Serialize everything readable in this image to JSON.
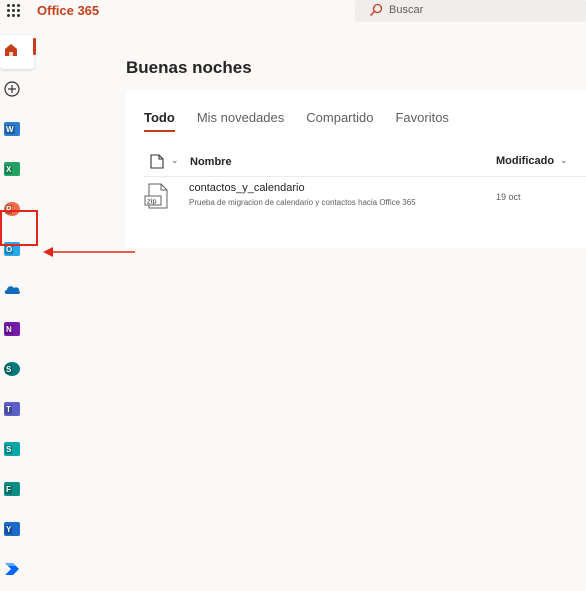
{
  "header": {
    "app_title": "Office 365",
    "search_placeholder": "Buscar"
  },
  "rail": {
    "apps": [
      {
        "name": "home",
        "color": "#c43e1c"
      },
      {
        "name": "create",
        "label": "+"
      },
      {
        "name": "word",
        "letter": "W",
        "color": "#185abd"
      },
      {
        "name": "excel",
        "letter": "X",
        "color": "#107c41"
      },
      {
        "name": "powerpoint",
        "letter": "P",
        "color": "#c43e1c"
      },
      {
        "name": "outlook",
        "letter": "O",
        "color": "#0078d4"
      },
      {
        "name": "onedrive",
        "color": "#0364b8"
      },
      {
        "name": "onenote",
        "letter": "N",
        "color": "#7719aa"
      },
      {
        "name": "sharepoint",
        "letter": "S",
        "color": "#038387"
      },
      {
        "name": "teams",
        "letter": "T",
        "color": "#4b53bc"
      },
      {
        "name": "sway",
        "letter": "S",
        "color": "#008272"
      },
      {
        "name": "forms",
        "letter": "F",
        "color": "#037c71"
      },
      {
        "name": "yammer",
        "letter": "Y",
        "color": "#106ebe"
      },
      {
        "name": "power-automate",
        "color": "#0066ff"
      }
    ]
  },
  "main": {
    "greeting": "Buenas noches",
    "tabs": [
      "Todo",
      "Mis novedades",
      "Compartido",
      "Favoritos"
    ],
    "columns": {
      "name": "Nombre",
      "modified": "Modificado"
    },
    "files": [
      {
        "name": "contactos_y_calendario",
        "description": "Prueba de migracion de calendario y contactos hacia Office 365",
        "modified": "19 oct",
        "type_label": "zip"
      }
    ]
  },
  "annotation": {
    "highlight_color": "#e3251c"
  }
}
